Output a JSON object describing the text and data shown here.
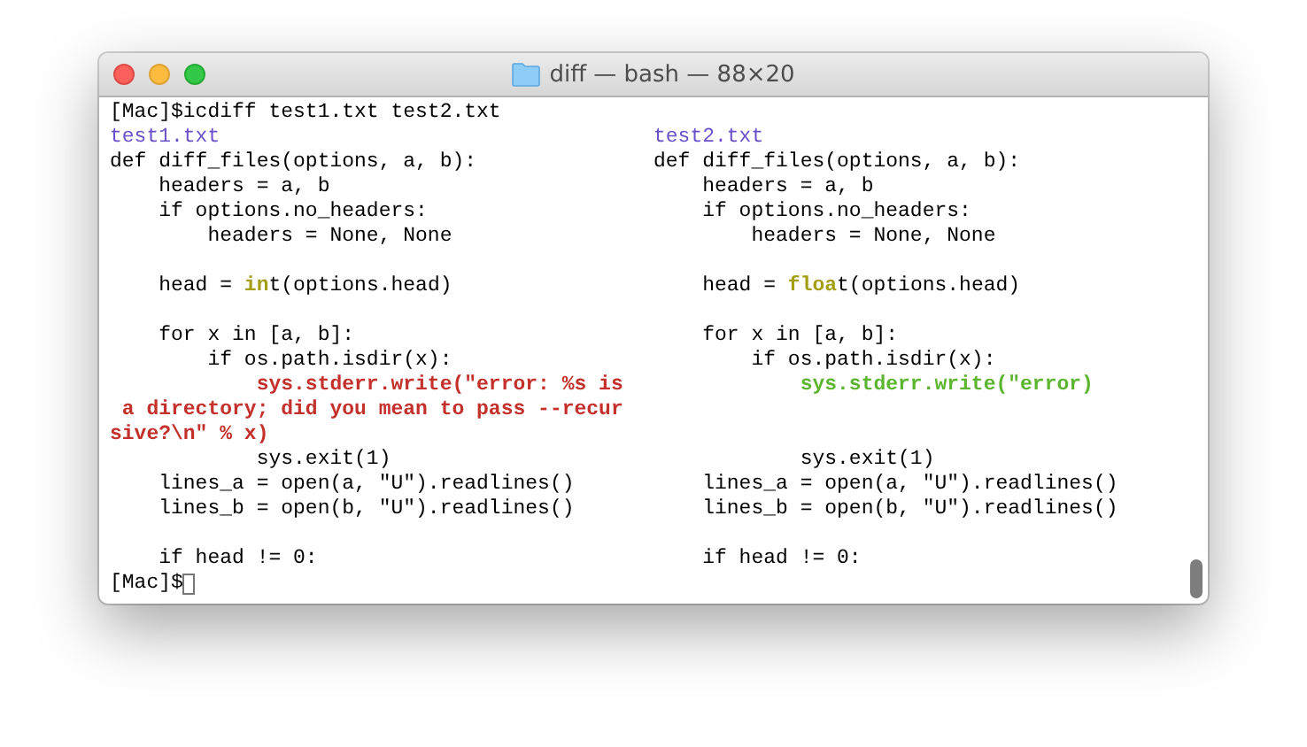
{
  "window": {
    "title": "diff — bash — 88×20"
  },
  "terminal": {
    "command_line": "[Mac]$icdiff test1.txt test2.txt",
    "rows": [
      {
        "left": [
          {
            "kind": "header",
            "text": "test1.txt"
          }
        ],
        "right": [
          {
            "kind": "header",
            "text": "test2.txt"
          }
        ]
      },
      {
        "left": [
          {
            "kind": "plain",
            "text": "def diff_files(options, a, b):"
          }
        ],
        "right": [
          {
            "kind": "plain",
            "text": "def diff_files(options, a, b):"
          }
        ]
      },
      {
        "left": [
          {
            "kind": "plain",
            "text": "    headers = a, b"
          }
        ],
        "right": [
          {
            "kind": "plain",
            "text": "    headers = a, b"
          }
        ]
      },
      {
        "left": [
          {
            "kind": "plain",
            "text": "    if options.no_headers:"
          }
        ],
        "right": [
          {
            "kind": "plain",
            "text": "    if options.no_headers:"
          }
        ]
      },
      {
        "left": [
          {
            "kind": "plain",
            "text": "        headers = None, None"
          }
        ],
        "right": [
          {
            "kind": "plain",
            "text": "        headers = None, None"
          }
        ]
      },
      {},
      {
        "left": [
          {
            "kind": "plain",
            "text": "    head = "
          },
          {
            "kind": "changed",
            "text": "in"
          },
          {
            "kind": "plain",
            "text": "t(options.head)"
          }
        ],
        "right": [
          {
            "kind": "plain",
            "text": "    head = "
          },
          {
            "kind": "changed",
            "text": "floa"
          },
          {
            "kind": "plain",
            "text": "t(options.head)"
          }
        ]
      },
      {},
      {
        "left": [
          {
            "kind": "plain",
            "text": "    for x in [a, b]:"
          }
        ],
        "right": [
          {
            "kind": "plain",
            "text": "    for x in [a, b]:"
          }
        ]
      },
      {
        "left": [
          {
            "kind": "plain",
            "text": "        if os.path.isdir(x):"
          }
        ],
        "right": [
          {
            "kind": "plain",
            "text": "        if os.path.isdir(x):"
          }
        ]
      },
      {
        "left": [
          {
            "kind": "deleted",
            "text": "            sys.stderr.write(\"error: %s is"
          }
        ],
        "right": [
          {
            "kind": "inserted",
            "text": "            sys.stderr.write(\"error)"
          }
        ]
      },
      {
        "left": [
          {
            "kind": "deleted",
            "text": " a directory; did you mean to pass --recur"
          }
        ]
      },
      {
        "left": [
          {
            "kind": "deleted",
            "text": "sive?\\n\" % x)"
          }
        ]
      },
      {
        "left": [
          {
            "kind": "plain",
            "text": "            sys.exit(1)"
          }
        ],
        "right": [
          {
            "kind": "plain",
            "text": "            sys.exit(1)"
          }
        ]
      },
      {
        "left": [
          {
            "kind": "plain",
            "text": "    lines_a = open(a, \"U\").readlines()"
          }
        ],
        "right": [
          {
            "kind": "plain",
            "text": "    lines_a = open(a, \"U\").readlines()"
          }
        ]
      },
      {
        "left": [
          {
            "kind": "plain",
            "text": "    lines_b = open(b, \"U\").readlines()"
          }
        ],
        "right": [
          {
            "kind": "plain",
            "text": "    lines_b = open(b, \"U\").readlines()"
          }
        ]
      },
      {},
      {
        "left": [
          {
            "kind": "plain",
            "text": "    if head != 0:"
          }
        ],
        "right": [
          {
            "kind": "plain",
            "text": "    if head != 0:"
          }
        ]
      }
    ],
    "prompt": "[Mac]$"
  }
}
